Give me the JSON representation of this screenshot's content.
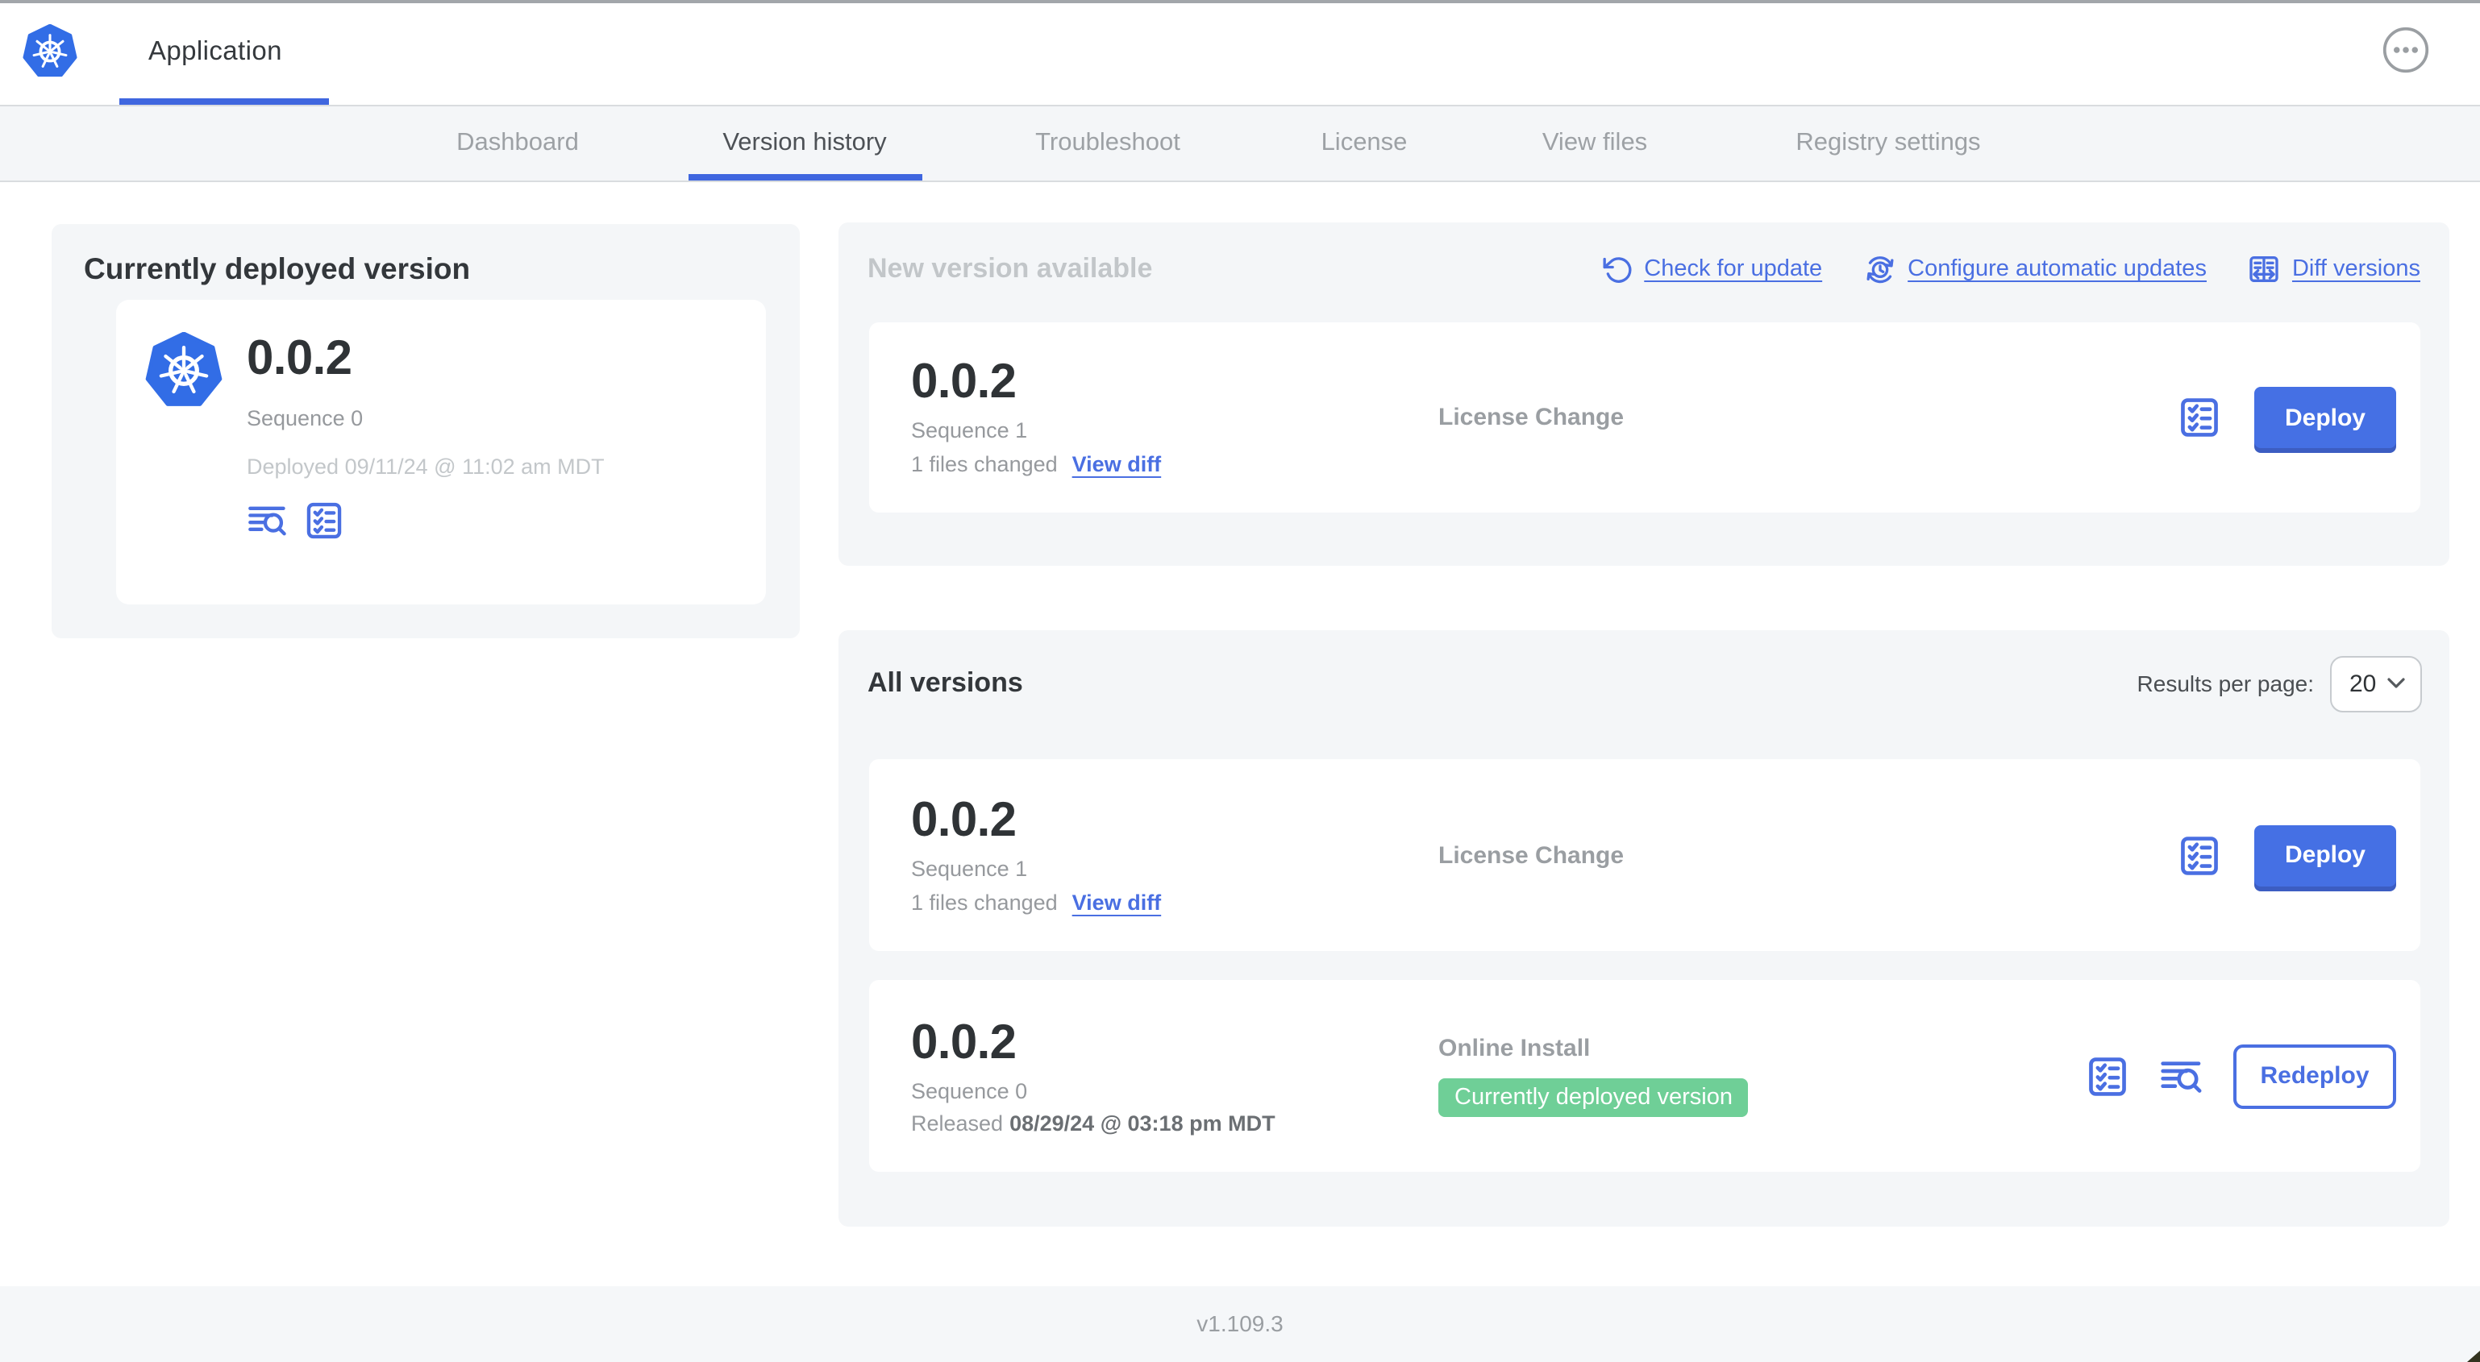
{
  "header": {
    "app_title": "Application"
  },
  "nav": {
    "tabs": [
      {
        "label": "Dashboard"
      },
      {
        "label": "Version history"
      },
      {
        "label": "Troubleshoot"
      },
      {
        "label": "License"
      },
      {
        "label": "View files"
      },
      {
        "label": "Registry settings"
      }
    ]
  },
  "current_version_panel": {
    "title": "Currently deployed version",
    "version": "0.0.2",
    "sequence": "Sequence 0",
    "deployed": "Deployed 09/11/24 @ 11:02 am MDT"
  },
  "new_version_panel": {
    "title": "New version available",
    "check_for_update": "Check for update",
    "configure_updates": "Configure automatic updates",
    "diff_versions": "Diff versions",
    "version": "0.0.2",
    "sequence": "Sequence 1",
    "files_changed": "1 files changed",
    "view_diff": "View diff",
    "source": "License Change",
    "deploy": "Deploy"
  },
  "all_versions_panel": {
    "title": "All versions",
    "results_per_page_label": "Results per page:",
    "results_per_page_value": "20",
    "rows": [
      {
        "version": "0.0.2",
        "sequence": "Sequence 1",
        "files_changed": "1 files changed",
        "view_diff": "View diff",
        "source": "License Change",
        "action": "Deploy"
      },
      {
        "version": "0.0.2",
        "sequence": "Sequence 0",
        "released_label": "Released",
        "released_date": "08/29/24 @ 03:18 pm MDT",
        "source": "Online Install",
        "badge": "Currently deployed version",
        "action": "Redeploy"
      }
    ]
  },
  "footer": {
    "app_version": "v1.109.3"
  },
  "colors": {
    "primary_blue": "#4A6FE2",
    "kubernetes_blue": "#326DE6",
    "badge_green": "#6FCF97",
    "panel_gray": "#F4F6F8"
  }
}
